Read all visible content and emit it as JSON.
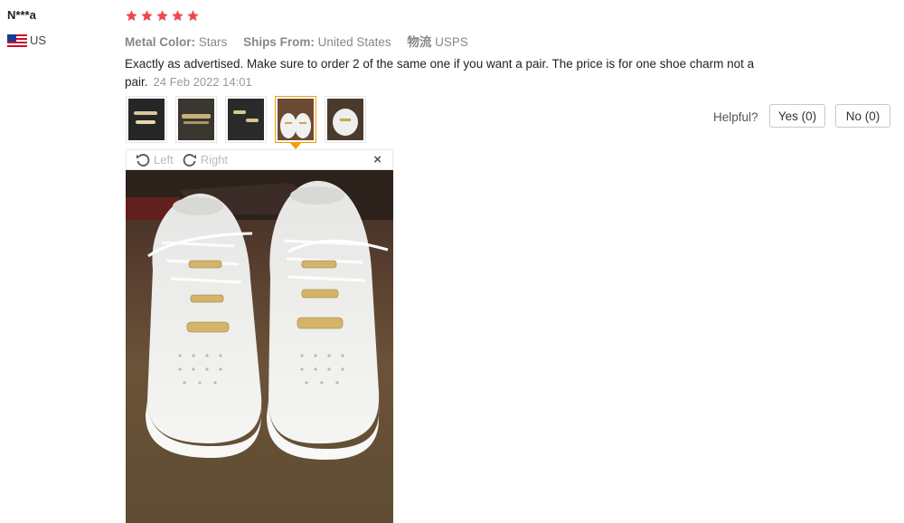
{
  "reviewer": {
    "name": "N***a",
    "country": "US",
    "flag_icon": "us-flag-icon"
  },
  "rating": {
    "stars": 5,
    "color": "#f0464f"
  },
  "attributes": [
    {
      "label": "Metal Color:",
      "value": "Stars"
    },
    {
      "label": "Ships From:",
      "value": "United States"
    },
    {
      "label": "物流",
      "value": "USPS"
    }
  ],
  "review": {
    "text": "Exactly as advertised. Make sure to order 2 of the same one if you want a pair. The price is for one shoe charm not a pair.",
    "date": "24 Feb 2022 14:01"
  },
  "thumbnails": {
    "count": 5,
    "selected_index": 3,
    "selected_color": "#f59c00"
  },
  "viewer": {
    "rotate_left": "Left",
    "rotate_right": "Right",
    "close": "×"
  },
  "helpful": {
    "label": "Helpful?",
    "yes": "Yes (0)",
    "no": "No (0)"
  }
}
